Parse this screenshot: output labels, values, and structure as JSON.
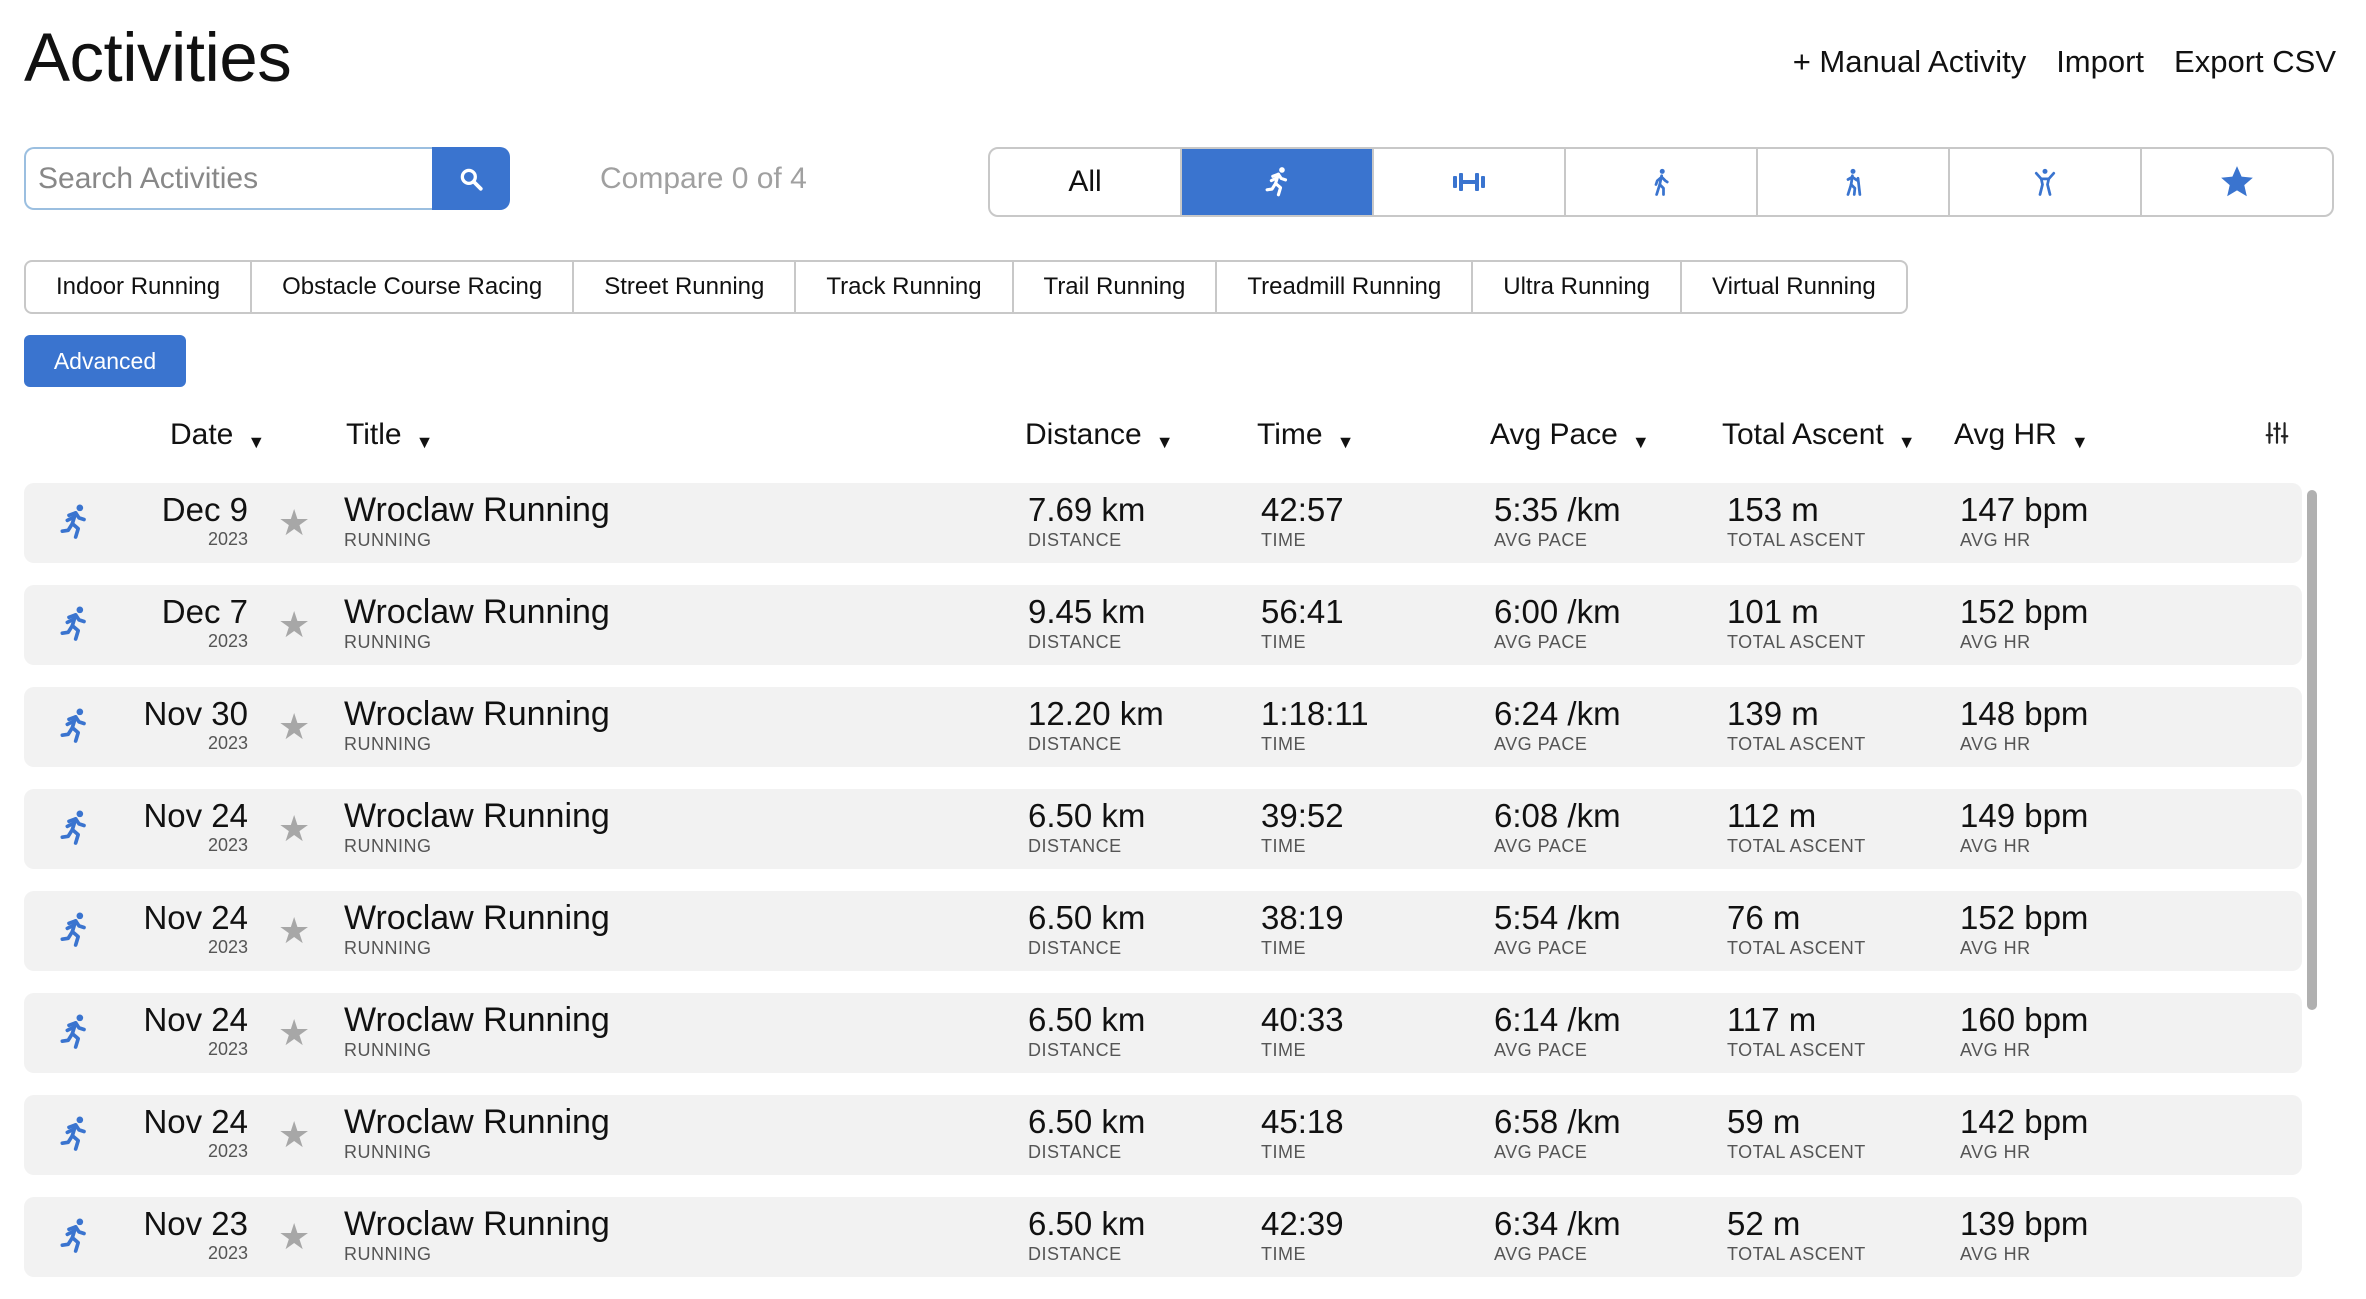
{
  "page": {
    "title": "Activities",
    "actions": {
      "manual": "+ Manual Activity",
      "import": "Import",
      "export": "Export CSV"
    }
  },
  "search": {
    "placeholder": "Search Activities",
    "value": ""
  },
  "compare_text": "Compare 0 of 4",
  "activity_types": [
    {
      "label": "All",
      "icon": "all",
      "active": false
    },
    {
      "label": "",
      "icon": "running-icon",
      "active": true
    },
    {
      "label": "",
      "icon": "strength-training-icon",
      "active": false
    },
    {
      "label": "",
      "icon": "walking-icon",
      "active": false
    },
    {
      "label": "",
      "icon": "hiking-icon",
      "active": false
    },
    {
      "label": "",
      "icon": "fitness-icon",
      "active": false
    },
    {
      "label": "",
      "icon": "star-icon",
      "active": false
    }
  ],
  "subtypes": [
    "Indoor Running",
    "Obstacle Course Racing",
    "Street Running",
    "Track Running",
    "Trail Running",
    "Treadmill Running",
    "Ultra Running",
    "Virtual Running"
  ],
  "advanced_label": "Advanced",
  "columns": {
    "date": "Date",
    "title": "Title",
    "distance": "Distance",
    "time": "Time",
    "avg_pace": "Avg Pace",
    "total_ascent": "Total Ascent",
    "avg_hr": "Avg HR"
  },
  "cell_labels": {
    "distance": "DISTANCE",
    "time": "TIME",
    "avg_pace": "AVG PACE",
    "total_ascent": "TOTAL ASCENT",
    "avg_hr": "AVG HR"
  },
  "colors": {
    "accent": "#3a74cf",
    "row_bg": "#f2f2f2",
    "star": "#a7a7a7"
  },
  "activities": [
    {
      "date": "Dec 9",
      "year": "2023",
      "title": "Wroclaw Running",
      "type": "RUNNING",
      "distance": "7.69 km",
      "time": "42:57",
      "avg_pace": "5:35 /km",
      "total_ascent": "153 m",
      "avg_hr": "147 bpm"
    },
    {
      "date": "Dec 7",
      "year": "2023",
      "title": "Wroclaw Running",
      "type": "RUNNING",
      "distance": "9.45 km",
      "time": "56:41",
      "avg_pace": "6:00 /km",
      "total_ascent": "101 m",
      "avg_hr": "152 bpm"
    },
    {
      "date": "Nov 30",
      "year": "2023",
      "title": "Wroclaw Running",
      "type": "RUNNING",
      "distance": "12.20 km",
      "time": "1:18:11",
      "avg_pace": "6:24 /km",
      "total_ascent": "139 m",
      "avg_hr": "148 bpm"
    },
    {
      "date": "Nov 24",
      "year": "2023",
      "title": "Wroclaw Running",
      "type": "RUNNING",
      "distance": "6.50 km",
      "time": "39:52",
      "avg_pace": "6:08 /km",
      "total_ascent": "112 m",
      "avg_hr": "149 bpm"
    },
    {
      "date": "Nov 24",
      "year": "2023",
      "title": "Wroclaw Running",
      "type": "RUNNING",
      "distance": "6.50 km",
      "time": "38:19",
      "avg_pace": "5:54 /km",
      "total_ascent": "76 m",
      "avg_hr": "152 bpm"
    },
    {
      "date": "Nov 24",
      "year": "2023",
      "title": "Wroclaw Running",
      "type": "RUNNING",
      "distance": "6.50 km",
      "time": "40:33",
      "avg_pace": "6:14 /km",
      "total_ascent": "117 m",
      "avg_hr": "160 bpm"
    },
    {
      "date": "Nov 24",
      "year": "2023",
      "title": "Wroclaw Running",
      "type": "RUNNING",
      "distance": "6.50 km",
      "time": "45:18",
      "avg_pace": "6:58 /km",
      "total_ascent": "59 m",
      "avg_hr": "142 bpm"
    },
    {
      "date": "Nov 23",
      "year": "2023",
      "title": "Wroclaw Running",
      "type": "RUNNING",
      "distance": "6.50 km",
      "time": "42:39",
      "avg_pace": "6:34 /km",
      "total_ascent": "52 m",
      "avg_hr": "139 bpm"
    }
  ]
}
